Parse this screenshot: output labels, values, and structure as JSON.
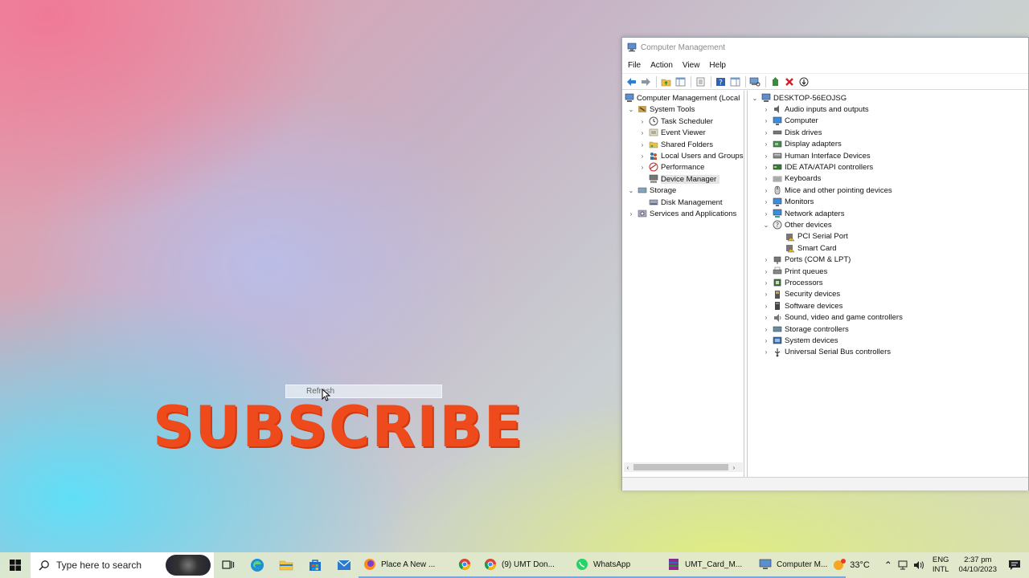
{
  "desktop": {
    "context_menu_item": "Refresh",
    "overlay_text": "SUBSCRIBE"
  },
  "window": {
    "title": "Computer Management",
    "menu": [
      "File",
      "Action",
      "View",
      "Help"
    ],
    "left_tree": [
      {
        "label": "Computer Management (Local",
        "chevron": "",
        "icon": "computer-management-icon"
      },
      {
        "label": "System Tools",
        "chevron": "⌄",
        "icon": "system-tools-icon"
      },
      {
        "label": "Task Scheduler",
        "chevron": "›",
        "icon": "task-scheduler-icon"
      },
      {
        "label": "Event Viewer",
        "chevron": "›",
        "icon": "event-viewer-icon"
      },
      {
        "label": "Shared Folders",
        "chevron": "›",
        "icon": "shared-folders-icon"
      },
      {
        "label": "Local Users and Groups",
        "chevron": "›",
        "icon": "users-icon"
      },
      {
        "label": "Performance",
        "chevron": "›",
        "icon": "performance-icon"
      },
      {
        "label": "Device Manager",
        "chevron": "",
        "icon": "device-manager-icon",
        "selected": true
      },
      {
        "label": "Storage",
        "chevron": "⌄",
        "icon": "storage-icon"
      },
      {
        "label": "Disk Management",
        "chevron": "",
        "icon": "disk-management-icon"
      },
      {
        "label": "Services and Applications",
        "chevron": "›",
        "icon": "services-icon"
      }
    ],
    "device_tree": [
      {
        "label": "DESKTOP-56EOJSG",
        "chevron": "⌄",
        "icon": "computer-icon"
      },
      {
        "label": "Audio inputs and outputs",
        "chevron": "›",
        "icon": "audio-icon"
      },
      {
        "label": "Computer",
        "chevron": "›",
        "icon": "monitor-icon"
      },
      {
        "label": "Disk drives",
        "chevron": "›",
        "icon": "disk-icon"
      },
      {
        "label": "Display adapters",
        "chevron": "›",
        "icon": "display-adapter-icon"
      },
      {
        "label": "Human Interface Devices",
        "chevron": "›",
        "icon": "hid-icon"
      },
      {
        "label": "IDE ATA/ATAPI controllers",
        "chevron": "›",
        "icon": "ide-icon"
      },
      {
        "label": "Keyboards",
        "chevron": "›",
        "icon": "keyboard-icon"
      },
      {
        "label": "Mice and other pointing devices",
        "chevron": "›",
        "icon": "mouse-icon"
      },
      {
        "label": "Monitors",
        "chevron": "›",
        "icon": "monitor-icon"
      },
      {
        "label": "Network adapters",
        "chevron": "›",
        "icon": "network-icon"
      },
      {
        "label": "Other devices",
        "chevron": "⌄",
        "icon": "other-devices-icon"
      },
      {
        "label": "PCI Serial Port",
        "chevron": "",
        "icon": "warning-device-icon"
      },
      {
        "label": "Smart Card",
        "chevron": "",
        "icon": "warning-device-icon"
      },
      {
        "label": "Ports (COM & LPT)",
        "chevron": "›",
        "icon": "port-icon"
      },
      {
        "label": "Print queues",
        "chevron": "›",
        "icon": "printer-icon"
      },
      {
        "label": "Processors",
        "chevron": "›",
        "icon": "processor-icon"
      },
      {
        "label": "Security devices",
        "chevron": "›",
        "icon": "security-icon"
      },
      {
        "label": "Software devices",
        "chevron": "›",
        "icon": "software-icon"
      },
      {
        "label": "Sound, video and game controllers",
        "chevron": "›",
        "icon": "sound-icon"
      },
      {
        "label": "Storage controllers",
        "chevron": "›",
        "icon": "storage-controller-icon"
      },
      {
        "label": "System devices",
        "chevron": "›",
        "icon": "system-device-icon"
      },
      {
        "label": "Universal Serial Bus controllers",
        "chevron": "›",
        "icon": "usb-icon"
      }
    ]
  },
  "taskbar": {
    "search_placeholder": "Type here to search",
    "apps": [
      {
        "label": "Place A New ...",
        "icon": "firefox-icon"
      },
      {
        "label": "",
        "icon": "chrome-icon"
      },
      {
        "label": "(9) UMT Don...",
        "icon": "chrome-icon"
      },
      {
        "label": "WhatsApp",
        "icon": "whatsapp-icon"
      },
      {
        "label": "UMT_Card_M...",
        "icon": "winrar-icon"
      },
      {
        "label": "Computer M...",
        "icon": "computer-management-icon"
      }
    ],
    "weather": "33°C",
    "lang_top": "ENG",
    "lang_bottom": "INTL",
    "time": "2:37 pm",
    "date": "04/10/2023"
  },
  "colors": {
    "subscribe": "#ee4a1c",
    "accent": "#0a64c8"
  }
}
